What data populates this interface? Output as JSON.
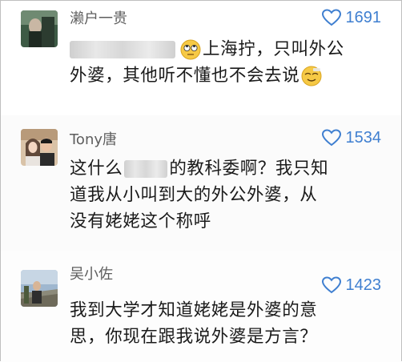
{
  "comments": [
    {
      "username": "濑户一贵",
      "likes": "1691",
      "line1": "上海拧，只叫外公",
      "line2": "外婆，其他听不懂也不会去说"
    },
    {
      "username": "Tony唐",
      "likes": "1534",
      "line1_a": "这什么",
      "line1_b": "的教科委啊？我只知",
      "line2": "道我从小叫到大的外公外婆，从",
      "line3": "没有姥姥这个称呼"
    },
    {
      "username": "吴小佐",
      "likes": "1423",
      "line1": "我到大学才知道姥姥是外婆的意",
      "line2": "思，你现在跟我说外婆是方言？"
    }
  ],
  "colors": {
    "accent": "#3f7fd0",
    "username": "#5e5e5e",
    "text": "#1a1a1a"
  },
  "icons": [
    "heart-outline-icon",
    "rolling-eyes-emoji",
    "relieved-emoji"
  ]
}
